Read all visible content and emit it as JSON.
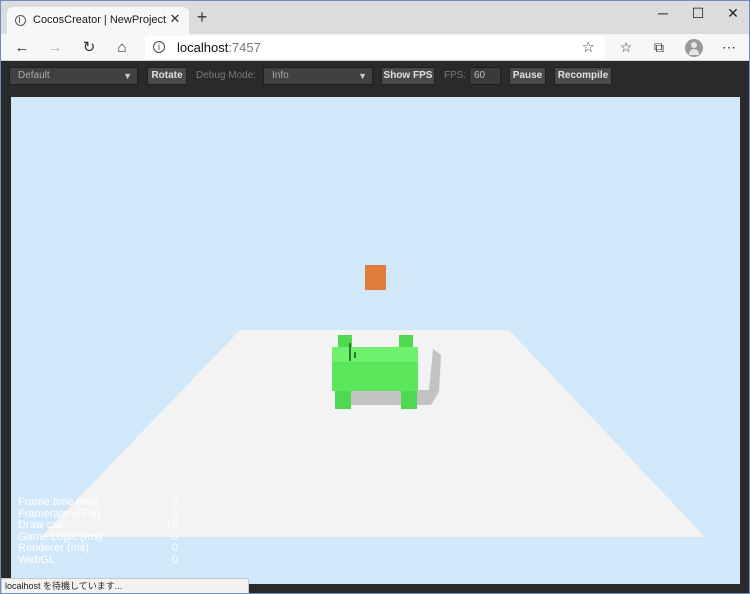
{
  "browser": {
    "tab_title": "CocosCreator | NewProject",
    "tab_close": "✕",
    "new_tab": "+",
    "window_controls": {
      "minimize": "─",
      "maximize": "☐",
      "close": "✕"
    },
    "url_host": "localhost",
    "url_port": ":7457",
    "status_text": "localhost を待機しています..."
  },
  "toolbar": {
    "device_select": "Default",
    "rotate_label": "Rotate",
    "debug_mode_label": "Debug Mode:",
    "debug_mode_value": "Info",
    "show_fps_label": "Show FPS",
    "fps_label": "FPS:",
    "fps_value": "60",
    "pause_label": "Pause",
    "recompile_label": "Recompile"
  },
  "stats": [
    {
      "label": "Frame time (ms)",
      "value": "0"
    },
    {
      "label": "Framerate (FPS)",
      "value": "0"
    },
    {
      "label": "Draw call",
      "value": "10"
    },
    {
      "label": "Game Logic (ms)",
      "value": "0"
    },
    {
      "label": "Renderer (ms)",
      "value": "0"
    },
    {
      "label": "WebGL",
      "value": "0"
    }
  ],
  "colors": {
    "sky": "#d1e8fb",
    "ground": "#f3f3f3",
    "cube_orange": "#e07b39",
    "body_green": "#5ce65c"
  }
}
